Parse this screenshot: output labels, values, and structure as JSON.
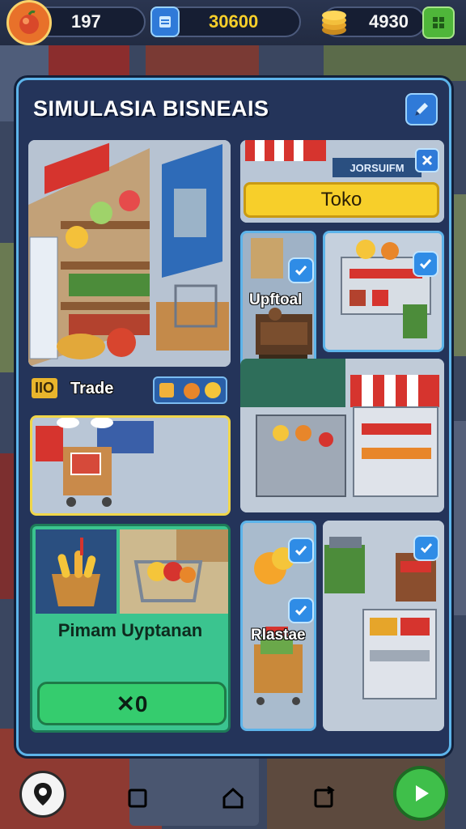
{
  "hud": {
    "level": "197",
    "gems": "30600",
    "coins": "4930"
  },
  "panel": {
    "title": "SIMULASIA BISNEAIS"
  },
  "cards": {
    "top_left_sign": "Trade",
    "top_left_sign_badge": "IIO",
    "store_tag": "JORSUIFM",
    "toko_button": "Toko",
    "uptoal_label": "Upftoal",
    "rlastae_label": "Rlastae",
    "promo_title": "Pimam Uyptanan",
    "promo_button": "✕0"
  },
  "colors": {
    "panel_bg": "#24345a",
    "panel_border": "#5db4ea",
    "toko_yellow": "#f7cf2a",
    "promo_green": "#3bc48f",
    "button_green": "#35cc6e"
  }
}
